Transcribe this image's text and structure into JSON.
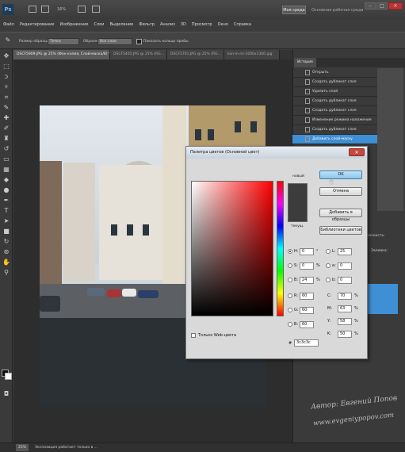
{
  "titlebar": {
    "logo": "Ps",
    "zoom": "16%",
    "workspace_button": "Моя среда",
    "workspace_label": "Основная рабочая среда",
    "minimize": "–",
    "maximize": "□",
    "close": "✕"
  },
  "menu": [
    "Файл",
    "Редактирование",
    "Изображение",
    "Слои",
    "Выделение",
    "Фильтр",
    "Анализ",
    "3D",
    "Просмотр",
    "Окно",
    "Справка"
  ],
  "options": {
    "sample_size_label": "Размер образца:",
    "sample_size_value": "Точка",
    "sample_label": "Образец:",
    "sample_value": "Все слои",
    "show_ring_label": "Показать кольцо пробы"
  },
  "doc_tabs": [
    "DSCF5909.JPG @ 25% (Фон копия, Слой-маска/8) *",
    "DSCF5405.JPG @ 25% (RG...",
    "DSCF5701.JPG @ 25% (RG...",
    "kon-in-ris-1000x1300.jpg"
  ],
  "history": {
    "tab": "История",
    "items": [
      "Открыть",
      "Создать дубликат слоя",
      "Удалить слой",
      "Создать дубликат слоя",
      "Создать дубликат слоя",
      "Изменение режима наложения",
      "Создать дубликат слоя",
      "Добавить слой-маску"
    ]
  },
  "layers": {
    "opacity_label": "зрачность:",
    "fill_label": "Заливка:"
  },
  "status": {
    "zoom": "25%",
    "text": "Экспозиция работает только в ..."
  },
  "dialog": {
    "title": "Палитра цветов (Основной цвет)",
    "close": "✕",
    "new_label": "новый",
    "current_label": "текущ.",
    "ok": "OK",
    "cancel": "Отмена",
    "add_to_swatches": "Добавить в образцы",
    "color_libraries": "Библиотеки цветов",
    "h": {
      "label": "H:",
      "value": "0",
      "unit": "°"
    },
    "s": {
      "label": "S:",
      "value": "0",
      "unit": "%"
    },
    "b": {
      "label": "B:",
      "value": "24",
      "unit": "%"
    },
    "r": {
      "label": "R:",
      "value": "60",
      "unit": ""
    },
    "g": {
      "label": "G:",
      "value": "60",
      "unit": ""
    },
    "bb": {
      "label": "B:",
      "value": "60",
      "unit": ""
    },
    "l": {
      "label": "L:",
      "value": "25",
      "unit": ""
    },
    "a": {
      "label": "a:",
      "value": "0",
      "unit": ""
    },
    "lab_b": {
      "label": "b:",
      "value": "0",
      "unit": ""
    },
    "c": {
      "label": "C:",
      "value": "70",
      "unit": "%"
    },
    "m": {
      "label": "M:",
      "value": "63",
      "unit": "%"
    },
    "y": {
      "label": "Y:",
      "value": "58",
      "unit": "%"
    },
    "k": {
      "label": "K:",
      "value": "50",
      "unit": "%"
    },
    "web_only": "Только Web-цвета",
    "hex_label": "#",
    "hex": "3c3c3c"
  },
  "watermark": {
    "line1": "Автор: Евгений Попов",
    "line2": "www.evgeniypopov.com"
  },
  "colors": {
    "selection": "#3f8fd4",
    "picked_color": "#3c3c3c"
  }
}
